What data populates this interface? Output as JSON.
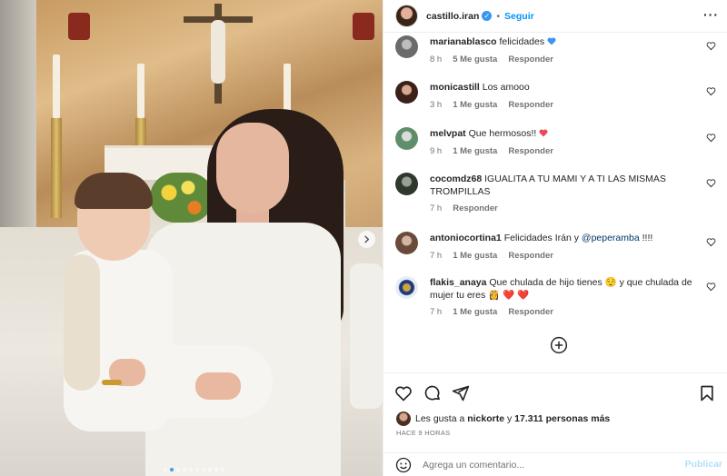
{
  "post": {
    "username": "castillo.iran",
    "follow_label": "Seguir",
    "dot": "•",
    "more_label": "···"
  },
  "comments": [
    {
      "username": "marianablasco",
      "text": "felicidades",
      "emoji": "blue-heart",
      "time": "8 h",
      "likes": "5 Me gusta",
      "reply": "Responder",
      "avatar_color": "#6b6b6b"
    },
    {
      "username": "monicastill",
      "text": "Los amooo",
      "time": "3 h",
      "likes": "1 Me gusta",
      "reply": "Responder",
      "avatar_color": "#7a4a3a"
    },
    {
      "username": "melvpat",
      "text": "Que hermosos!!",
      "emoji": "red-heart",
      "time": "9 h",
      "likes": "1 Me gusta",
      "reply": "Responder",
      "avatar_color": "#5f8f6a"
    },
    {
      "username": "cocomdz68",
      "text": "IGUALITA A TU MAMI Y A TI LAS MISMAS TROMPILLAS",
      "time": "7 h",
      "reply": "Responder",
      "avatar_color": "#3f4a3b"
    },
    {
      "username": "antoniocortina1",
      "text_before": "Felicidades Irán y",
      "mention": "@peperamba",
      "text_after": "!!!!",
      "time": "7 h",
      "likes": "1 Me gusta",
      "reply": "Responder",
      "avatar_color": "#8a6a5a"
    },
    {
      "username": "flakis_anaya",
      "text": "Que chulada de hijo tienes 😌 y que chulada de mujer tu eres 👸 ❤️ ❤️",
      "time": "7 h",
      "likes": "1 Me gusta",
      "reply": "Responder",
      "avatar_color": "#2f4a8a"
    }
  ],
  "likes": {
    "prefix": "Les gusta a",
    "user": "nickorte",
    "joiner": "y",
    "count": "17.311 personas más"
  },
  "timestamp": "HACE 9 HORAS",
  "composer": {
    "placeholder": "Agrega un comentario...",
    "post_label": "Publicar"
  },
  "colors": {
    "accent": "#0095f6",
    "verified": "#3797f0",
    "heart": "#ed4956",
    "blue_heart": "#3897f0",
    "muted": "#737373"
  },
  "icons": [
    "chevron-right-icon",
    "verified-icon",
    "more-icon",
    "heart-icon",
    "comment-icon",
    "share-icon",
    "bookmark-icon",
    "add-circle-icon",
    "emoji-icon"
  ],
  "carousel": {
    "count": 10,
    "active_index": 1
  }
}
